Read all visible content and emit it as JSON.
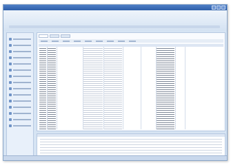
{
  "window": {
    "title": "",
    "page_title": ""
  },
  "sidebar": {
    "items": [
      "",
      "",
      "",
      "",
      "",
      "",
      "",
      "",
      "",
      "",
      "",
      "",
      "",
      "",
      ""
    ]
  },
  "main": {
    "tabs": [
      "",
      "",
      ""
    ],
    "toolbar_items": [
      "",
      "",
      "",
      "",
      "",
      "",
      "",
      "",
      ""
    ],
    "grid": {
      "columns": [
        "",
        "",
        "",
        "",
        "",
        "",
        "",
        "",
        "",
        ""
      ],
      "row_count": 42
    }
  },
  "detail_panel": {
    "row_count": 7
  },
  "colors": {
    "titlebar": "#2d5ea8",
    "background": "#d6e4f3",
    "accent": "#6f93c6"
  }
}
